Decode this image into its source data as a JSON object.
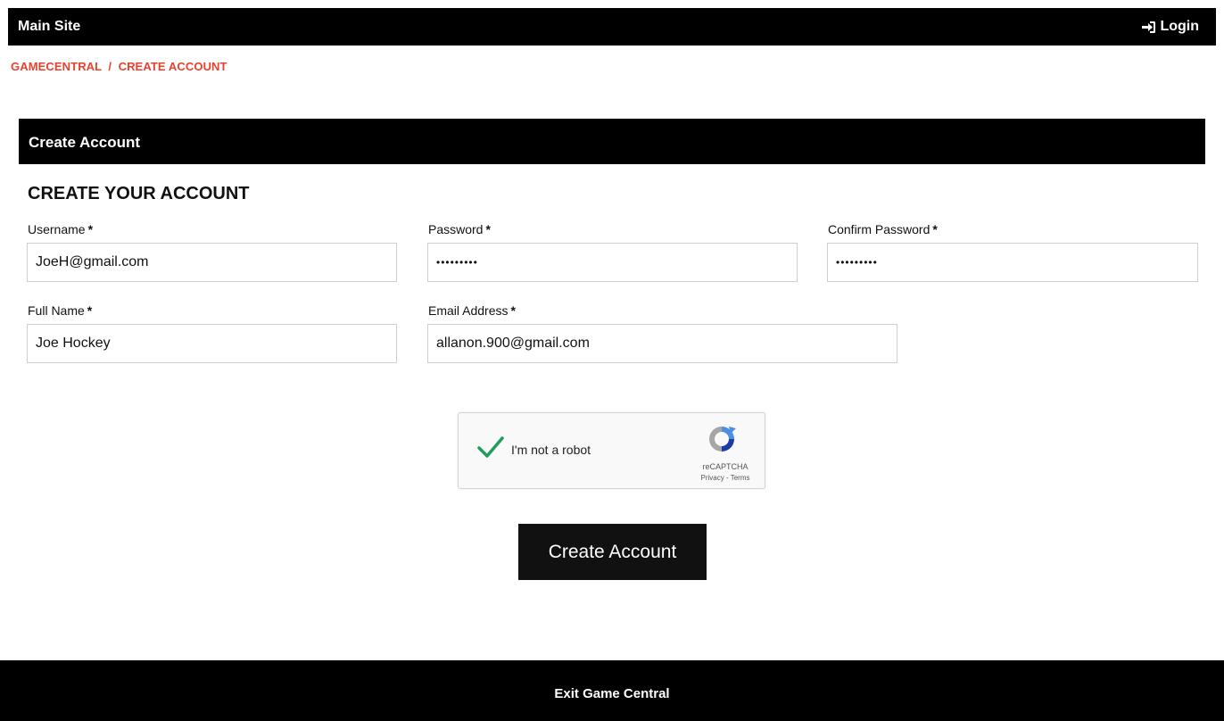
{
  "topbar": {
    "site_label": "Main Site",
    "login_label": "Login",
    "login_icon": "sign-in-icon"
  },
  "breadcrumb": {
    "home": "GAMECENTRAL",
    "separator": "/",
    "current": "CREATE ACCOUNT"
  },
  "panel": {
    "title": "Create Account"
  },
  "form": {
    "heading": "CREATE YOUR ACCOUNT",
    "required_marker": "*",
    "username": {
      "label": "Username",
      "value": "JoeH@gmail.com"
    },
    "password": {
      "label": "Password",
      "value": "•••••••••"
    },
    "confirm_password": {
      "label": "Confirm Password",
      "value": "•••••••••"
    },
    "full_name": {
      "label": "Full Name",
      "value": "Joe Hockey"
    },
    "email": {
      "label": "Email Address",
      "value": "allanon.900@gmail.com"
    }
  },
  "captcha": {
    "label": "I'm not a robot",
    "checked": true,
    "brand": "reCAPTCHA",
    "links": "Privacy - Terms",
    "check_icon": "checkmark-icon",
    "logo_icon": "recaptcha-logo-icon"
  },
  "submit": {
    "label": "Create Account"
  },
  "footer": {
    "exit_label": "Exit Game Central"
  },
  "colors": {
    "accent": "#e8412c",
    "bar": "#000000",
    "button": "#111111",
    "check": "#1e9e5a"
  }
}
